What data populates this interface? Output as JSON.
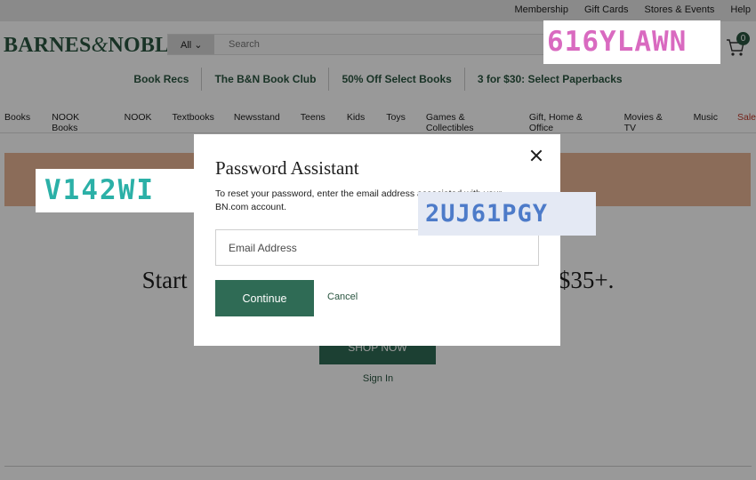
{
  "utility_bar": {
    "links": [
      "Membership",
      "Gift Cards",
      "Stores & Events",
      "Help"
    ]
  },
  "header": {
    "logo_left": "BARNES",
    "logo_amp": "&",
    "logo_right": "NOBLE",
    "search_scope": "All",
    "search_placeholder": "Search",
    "cart_count": "0"
  },
  "promo_nav": [
    "Book Recs",
    "The B&N Book Club",
    "50% Off Select Books",
    "3 for $30: Select Paperbacks"
  ],
  "category_nav": [
    "Books",
    "NOOK Books",
    "NOOK",
    "Textbooks",
    "Newsstand",
    "Teens",
    "Kids",
    "Toys",
    "Games & Collectibles",
    "Gift, Home & Office",
    "Movies & TV",
    "Music",
    "Sale"
  ],
  "hero": {
    "text_left": "Start shop",
    "text_right": "rs of $35+.",
    "shop_now": "SHOP NOW",
    "sign_in": "Sign In"
  },
  "modal": {
    "title": "Password Assistant",
    "description": "To reset your password, enter the email address associated with your BN.com account.",
    "email_placeholder": "Email Address",
    "continue_label": "Continue",
    "cancel_label": "Cancel"
  },
  "captchas": {
    "top_right": "616YLAWN",
    "left": "V142WI",
    "center": "2UJ61PGY"
  },
  "colors": {
    "brand_green": "#2a5540",
    "button_green": "#2f6b55",
    "banner_salmon": "#e8b495",
    "sale_red": "#c0392b"
  }
}
